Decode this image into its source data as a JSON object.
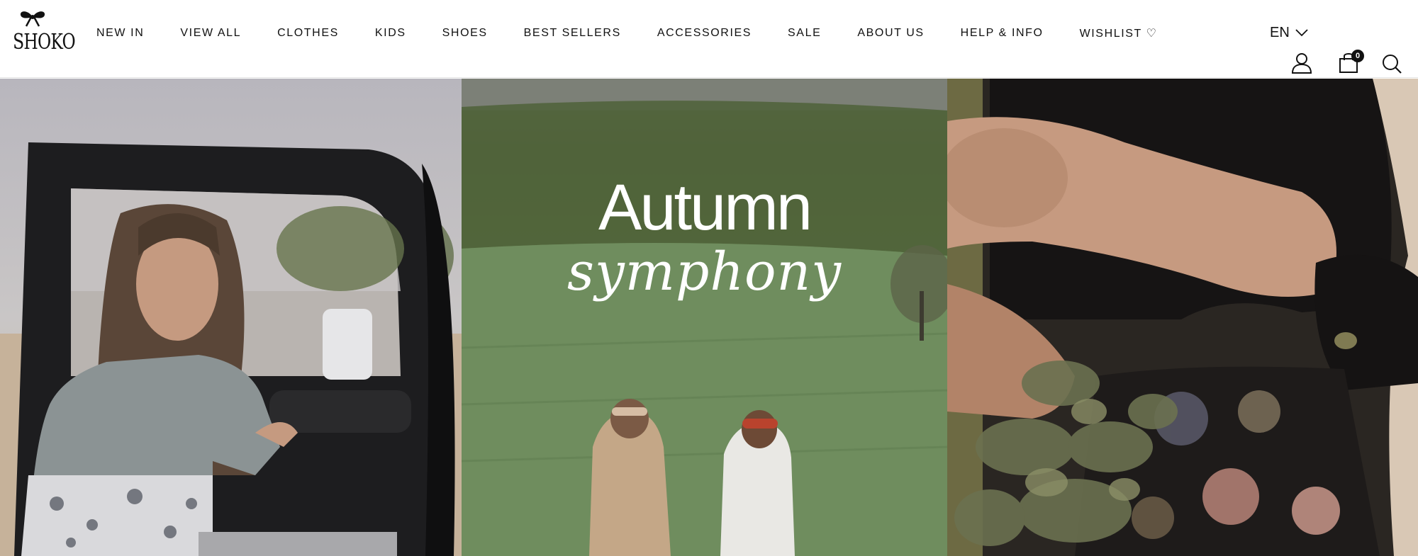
{
  "header": {
    "logo_text": "SHOKO",
    "nav": [
      {
        "label": "NEW IN"
      },
      {
        "label": "VIEW ALL"
      },
      {
        "label": "CLOTHES"
      },
      {
        "label": "KIDS"
      },
      {
        "label": "SHOES"
      },
      {
        "label": "BEST SELLERS"
      },
      {
        "label": "ACCESSORIES"
      },
      {
        "label": "SALE"
      },
      {
        "label": "ABOUT US"
      },
      {
        "label": "HELP & INFO"
      },
      {
        "label": "WISHLIST ♡"
      }
    ],
    "language": "EN",
    "cart_count": "0"
  },
  "hero": {
    "title": "Autumn",
    "subtitle": "symphony"
  },
  "icons": {
    "logo": "bow-logo-icon",
    "language": "chevron-down-icon",
    "account": "user-icon",
    "cart": "shopping-bag-icon",
    "search": "search-icon"
  },
  "colors": {
    "header_bg": "#ffffff",
    "text": "#111111",
    "hero_text": "#ffffff",
    "badge_bg": "#111111"
  }
}
